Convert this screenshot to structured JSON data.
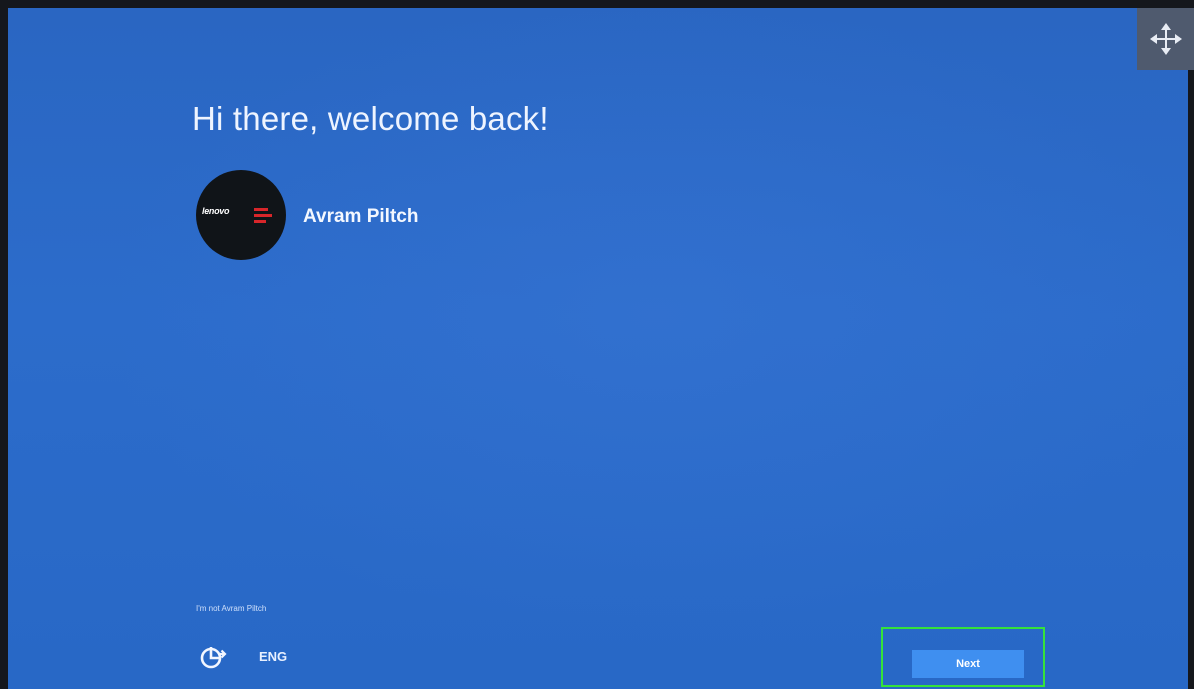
{
  "welcome": {
    "title": "Hi there, welcome back!"
  },
  "account": {
    "name": "Avram Piltch",
    "avatar_logo_text": "lenovo"
  },
  "footer": {
    "not_user_link": "I'm not Avram Piltch",
    "language": "ENG",
    "accessibility_icon": "ease-of-access-icon"
  },
  "actions": {
    "next_label": "Next",
    "highlight_color": "#35e23a"
  },
  "overlay": {
    "move_icon": "move-arrows-icon"
  },
  "colors": {
    "background": "#2a66c2",
    "button": "#3f8ff0"
  }
}
